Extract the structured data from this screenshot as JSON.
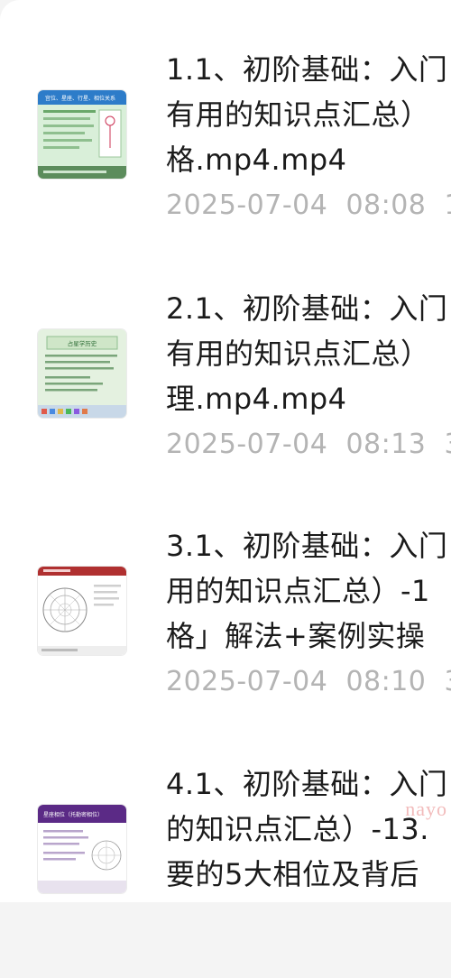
{
  "files": [
    {
      "title_lines": [
        "1.1、初阶基础：入门",
        "有用的知识点汇总）",
        "格.mp4.mp4"
      ],
      "date": "2025-07-04",
      "time": "08:08",
      "extra": "1",
      "thumb": {
        "name": "thumb-1",
        "header_text": "宫位、星座、行星、相位关系",
        "accent": "#2d7cc9",
        "bg": "#d9efd9"
      }
    },
    {
      "title_lines": [
        "2.1、初阶基础：入门",
        "有用的知识点汇总）",
        "理.mp4.mp4"
      ],
      "date": "2025-07-04",
      "time": "08:13",
      "extra": "3",
      "thumb": {
        "name": "thumb-2",
        "header_text": "占星学历史",
        "accent": "#3f8f4a",
        "bg": "#e4f1e0"
      }
    },
    {
      "title_lines": [
        "3.1、初阶基础：入门",
        "用的知识点汇总）-1",
        "格」解法+案例实操"
      ],
      "date": "2025-07-04",
      "time": "08:10",
      "extra": "3",
      "thumb": {
        "name": "thumb-3",
        "header_text": "",
        "accent": "#b03030",
        "bg": "#ffffff"
      }
    },
    {
      "title_lines": [
        "4.1、初阶基础：入门",
        "的知识点汇总）-13.",
        "要的5大相位及背后"
      ],
      "date": "",
      "time": "",
      "extra": "",
      "thumb": {
        "name": "thumb-4",
        "header_text": "星座相位（托勒密相位）",
        "accent": "#5b2a86",
        "bg": "#ffffff"
      }
    }
  ],
  "watermark": "nayo"
}
